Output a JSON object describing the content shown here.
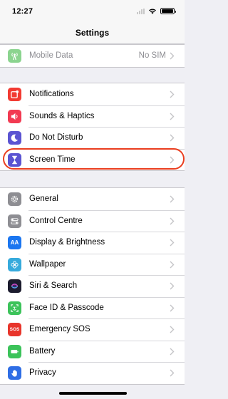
{
  "status_bar": {
    "time": "12:27"
  },
  "nav": {
    "title": "Settings"
  },
  "group_top": [
    {
      "label": "Mobile Data",
      "value": "No SIM",
      "icon": "antenna-icon",
      "color": "#8bd48f",
      "dim": true
    }
  ],
  "group_notifications": [
    {
      "label": "Notifications",
      "icon": "notifications-icon",
      "color": "#f23a32"
    },
    {
      "label": "Sounds & Haptics",
      "icon": "speaker-icon",
      "color": "#f23a52"
    },
    {
      "label": "Do Not Disturb",
      "icon": "moon-icon",
      "color": "#5b54d2"
    },
    {
      "label": "Screen Time",
      "icon": "hourglass-icon",
      "color": "#5b54d2"
    }
  ],
  "group_general": [
    {
      "label": "General",
      "icon": "gear-icon",
      "color": "#8e8e93"
    },
    {
      "label": "Control Centre",
      "icon": "control-centre-icon",
      "color": "#8e8e93"
    },
    {
      "label": "Display & Brightness",
      "icon": "display-icon",
      "color": "#1b76f0",
      "glyph": "AA"
    },
    {
      "label": "Wallpaper",
      "icon": "wallpaper-flower-icon",
      "color": "#36aadc"
    },
    {
      "label": "Siri & Search",
      "icon": "siri-icon",
      "color": "#1c1c2e"
    },
    {
      "label": "Face ID & Passcode",
      "icon": "face-id-icon",
      "color": "#3cc35a"
    },
    {
      "label": "Emergency SOS",
      "icon": "sos-icon",
      "color": "#e8352b",
      "glyph": "SOS"
    },
    {
      "label": "Battery",
      "icon": "battery-icon",
      "color": "#3cc35a"
    },
    {
      "label": "Privacy",
      "icon": "hand-icon",
      "color": "#2f6ee5"
    }
  ],
  "colors": {
    "highlight_ring": "#ea3e1f",
    "background": "#efeff4"
  }
}
